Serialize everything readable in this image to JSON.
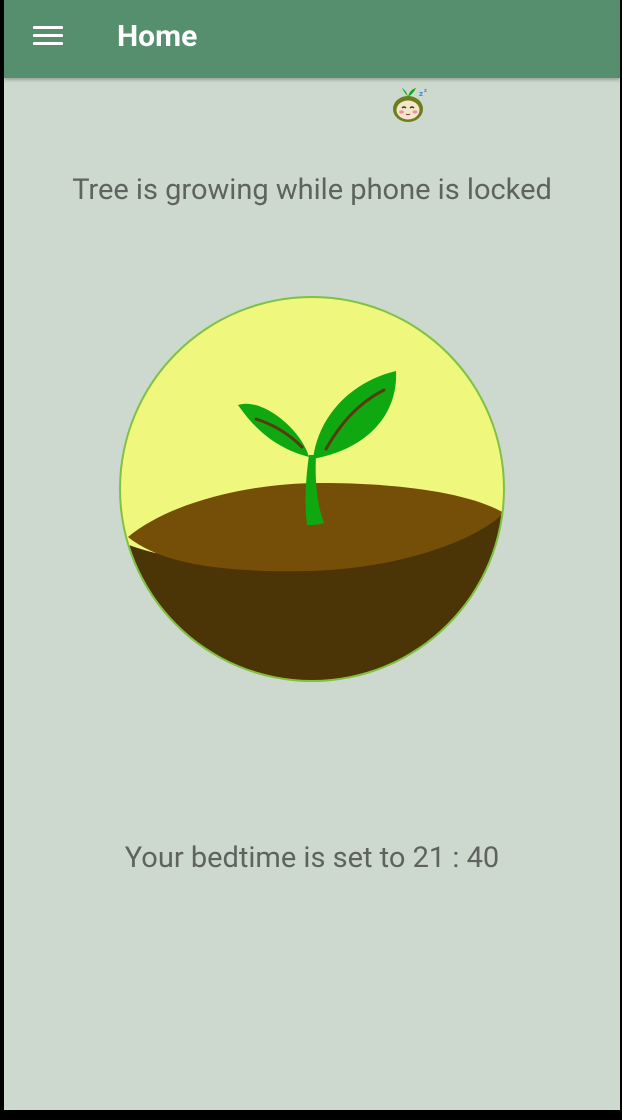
{
  "app_bar": {
    "title": "Home",
    "menu_icon": "hamburger-menu-icon"
  },
  "mascot": {
    "icon": "sleeping-seed-mascot-icon"
  },
  "main": {
    "status_text": "Tree is growing while phone is locked",
    "bedtime_text": "Your bedtime is set to 21 : 40"
  },
  "colors": {
    "app_bar": "#568f6e",
    "background": "#cdd8ce",
    "ring": "#7ec242",
    "sky": "#f0f77d",
    "soil_top": "#754f08",
    "soil_bottom": "#4b3406",
    "plant": "#10a810",
    "text": "#5e6360"
  }
}
